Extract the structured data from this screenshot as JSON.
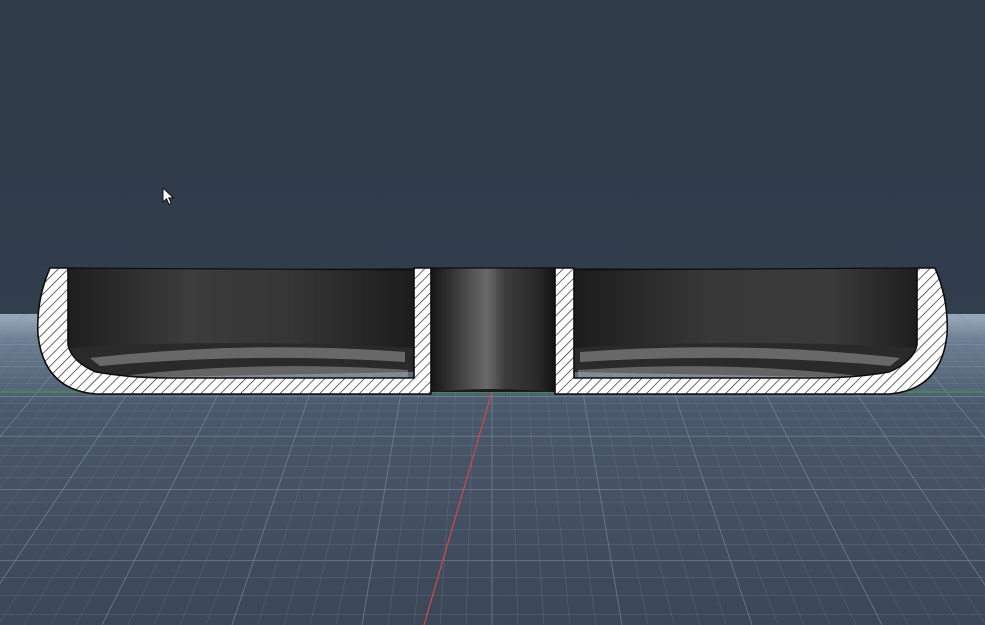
{
  "viewport": {
    "background_color": "#313d4b",
    "horizon_glow_color": "#aebfd0",
    "ground_color": "#3f4d5f",
    "grid_line_color": "#8394a8",
    "x_axis_color": "#d14a4a",
    "y_axis_color": "#3f9a4f"
  },
  "model": {
    "view": "cross-section",
    "section_fill_color": "#ffffff",
    "hatch_color": "#1a1a1a",
    "interior_color": "#2e2e2e",
    "outline_color": "#0d0d0d"
  },
  "cursor": {
    "icon": "arrow-cursor-icon"
  }
}
